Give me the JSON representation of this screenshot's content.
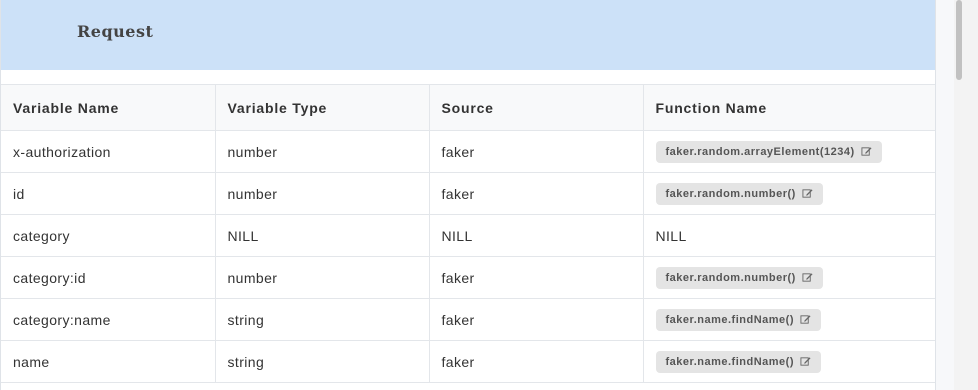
{
  "header": {
    "title": "Request"
  },
  "table": {
    "columns": [
      "Variable Name",
      "Variable Type",
      "Source",
      "Function Name"
    ],
    "rows": [
      {
        "name": "x-authorization",
        "type": "number",
        "source": "faker",
        "function": "faker.random.arrayElement(1234)",
        "editable": true
      },
      {
        "name": "id",
        "type": "number",
        "source": "faker",
        "function": "faker.random.number()",
        "editable": true
      },
      {
        "name": "category",
        "type": "NILL",
        "source": "NILL",
        "function": "NILL",
        "editable": false
      },
      {
        "name": "category:id",
        "type": "number",
        "source": "faker",
        "function": "faker.random.number()",
        "editable": true
      },
      {
        "name": "category:name",
        "type": "string",
        "source": "faker",
        "function": "faker.name.findName()",
        "editable": true
      },
      {
        "name": "name",
        "type": "string",
        "source": "faker",
        "function": "faker.name.findName()",
        "editable": true
      }
    ]
  },
  "icons": {
    "edit": "edit-icon"
  }
}
